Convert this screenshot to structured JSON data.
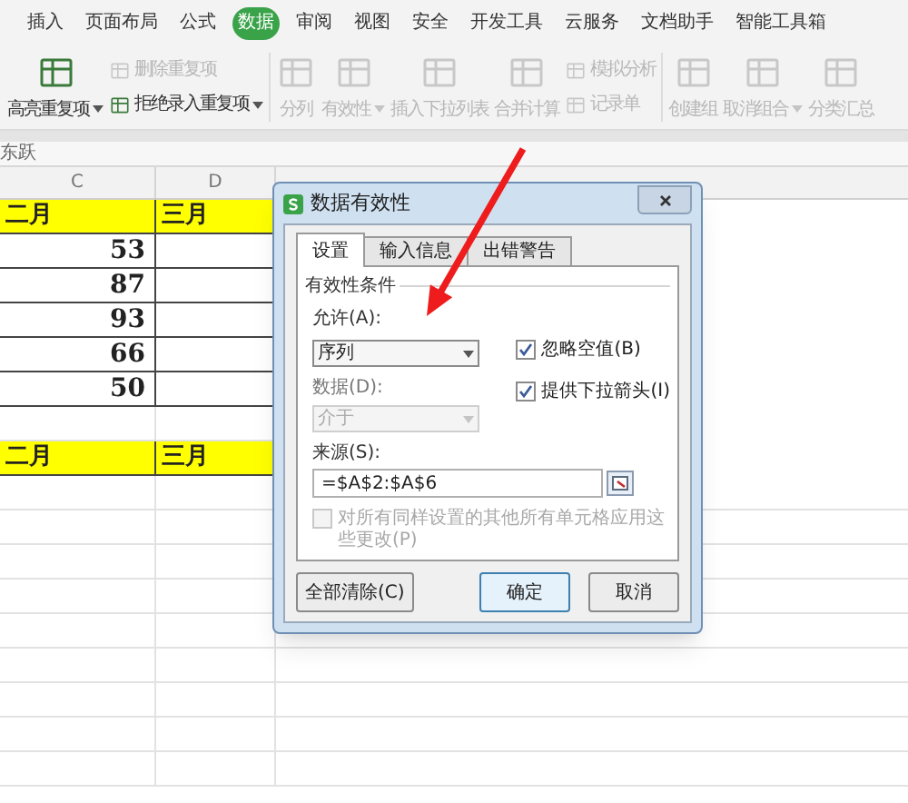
{
  "menu_tabs": [
    {
      "label": "插入",
      "selected": false
    },
    {
      "label": "页面布局",
      "selected": false
    },
    {
      "label": "公式",
      "selected": false
    },
    {
      "label": "数据",
      "selected": true
    },
    {
      "label": "审阅",
      "selected": false
    },
    {
      "label": "视图",
      "selected": false
    },
    {
      "label": "安全",
      "selected": false
    },
    {
      "label": "开发工具",
      "selected": false
    },
    {
      "label": "云服务",
      "selected": false
    },
    {
      "label": "文档助手",
      "selected": false
    },
    {
      "label": "智能工具箱",
      "selected": false
    }
  ],
  "ribbon": [
    {
      "kind": "large",
      "label": "高亮重复项",
      "caret": true,
      "disabled": false
    },
    {
      "kind": "stack",
      "items": [
        {
          "label": "删除重复项",
          "caret": false,
          "disabled": true
        },
        {
          "label": "拒绝录入重复项",
          "caret": true,
          "disabled": false
        }
      ]
    },
    {
      "kind": "divider"
    },
    {
      "kind": "large",
      "label": "分列",
      "caret": false,
      "disabled": true
    },
    {
      "kind": "large",
      "label": "有效性",
      "caret": true,
      "disabled": true
    },
    {
      "kind": "large",
      "label": "插入下拉列表",
      "caret": false,
      "disabled": true
    },
    {
      "kind": "large",
      "label": "合并计算",
      "caret": false,
      "disabled": true
    },
    {
      "kind": "stack",
      "items": [
        {
          "label": "模拟分析",
          "caret": false,
          "disabled": true
        },
        {
          "label": "记录单",
          "caret": false,
          "disabled": true
        }
      ]
    },
    {
      "kind": "divider"
    },
    {
      "kind": "large",
      "label": "创建组",
      "caret": false,
      "disabled": true
    },
    {
      "kind": "large",
      "label": "取消组合",
      "caret": true,
      "disabled": true
    },
    {
      "kind": "large",
      "label": "分类汇总",
      "caret": false,
      "disabled": true
    }
  ],
  "formula_bar": {
    "value": "东跃"
  },
  "sheet": {
    "columns": [
      "C",
      "D"
    ],
    "rows": [
      {
        "kind": "header",
        "cells": [
          "二月",
          "三月"
        ]
      },
      {
        "kind": "value",
        "cells": [
          "53"
        ]
      },
      {
        "kind": "value",
        "cells": [
          "87"
        ]
      },
      {
        "kind": "value",
        "cells": [
          "93"
        ]
      },
      {
        "kind": "value",
        "cells": [
          "66"
        ]
      },
      {
        "kind": "value",
        "cells": [
          "50"
        ]
      },
      {
        "kind": "empty"
      },
      {
        "kind": "header",
        "cells": [
          "二月",
          "三月"
        ]
      }
    ]
  },
  "dialog": {
    "title": "数据有效性",
    "tabs": [
      {
        "label": "设置",
        "selected": true
      },
      {
        "label": "输入信息",
        "selected": false
      },
      {
        "label": "出错警告",
        "selected": false
      }
    ],
    "group_title": "有效性条件",
    "allow": {
      "label": "允许(A):",
      "value": "序列",
      "disabled": false
    },
    "data": {
      "label": "数据(D):",
      "value": "介于",
      "disabled": true
    },
    "checkboxes": [
      {
        "label": "忽略空值(B)",
        "checked": true,
        "disabled": false
      },
      {
        "label": "提供下拉箭头(I)",
        "checked": true,
        "disabled": false
      }
    ],
    "source": {
      "label": "来源(S):",
      "value": "=$A$2:$A$6"
    },
    "apply_all": {
      "label": "对所有同样设置的其他所有单元格应用这些更改(P)",
      "checked": false,
      "disabled": true
    },
    "buttons": [
      {
        "label": "全部清除(C)",
        "kind": "secondary"
      },
      {
        "label": "确定",
        "kind": "default"
      },
      {
        "label": "取消",
        "kind": "secondary"
      }
    ]
  }
}
